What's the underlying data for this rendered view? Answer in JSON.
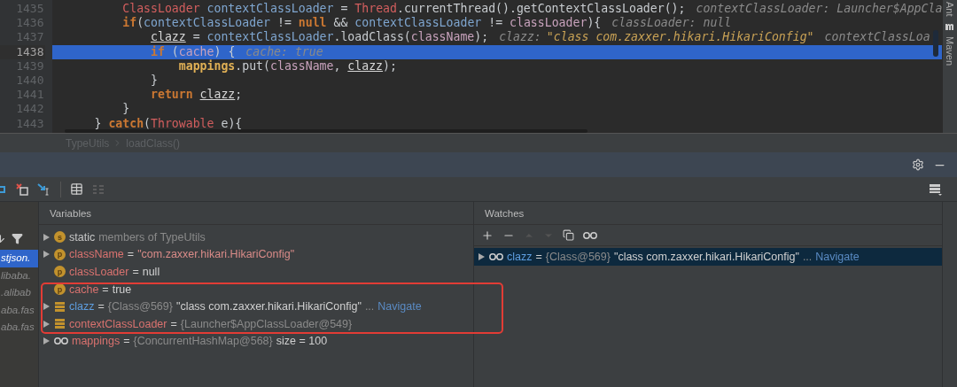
{
  "editor": {
    "lines": [
      {
        "number": "1435",
        "selected": false,
        "tokens": [
          {
            "kind": "type",
            "text": "          ClassLoader"
          },
          {
            "kind": "local",
            "text": " contextClassLoader"
          },
          {
            "kind": "plain",
            "text": " = "
          },
          {
            "kind": "type",
            "text": "Thread"
          },
          {
            "kind": "plain",
            "text": ".currentThread().getContextClassLoader();"
          },
          {
            "kind": "hint",
            "text": "contextClassLoader: Launcher$AppCla"
          }
        ]
      },
      {
        "number": "1436",
        "selected": false,
        "tokens": [
          {
            "kind": "keyword",
            "text": "          if"
          },
          {
            "kind": "plain",
            "text": "("
          },
          {
            "kind": "local",
            "text": "contextClassLoader"
          },
          {
            "kind": "plain",
            "text": " != "
          },
          {
            "kind": "keyword",
            "text": "null"
          },
          {
            "kind": "plain",
            "text": " && "
          },
          {
            "kind": "local",
            "text": "contextClassLoader"
          },
          {
            "kind": "plain",
            "text": " != "
          },
          {
            "kind": "param",
            "text": "classLoader"
          },
          {
            "kind": "plain",
            "text": "){"
          },
          {
            "kind": "hint",
            "text": "classLoader: null"
          }
        ]
      },
      {
        "number": "1437",
        "selected": false,
        "tokens": [
          {
            "kind": "mutated",
            "text": "              clazz"
          },
          {
            "kind": "plain",
            "text": " = "
          },
          {
            "kind": "local",
            "text": "contextClassLoader"
          },
          {
            "kind": "plain",
            "text": ".loadClass("
          },
          {
            "kind": "param",
            "text": "className"
          },
          {
            "kind": "plain",
            "text": ");"
          },
          {
            "kind": "hint",
            "text": "clazz:"
          },
          {
            "kind": "hintstr",
            "text": "\"class com.zaxxer.hikari.HikariConfig\""
          },
          {
            "kind": "hint",
            "text": "contextClassLoa"
          }
        ]
      },
      {
        "number": "1438",
        "selected": true,
        "tokens": [
          {
            "kind": "keyword",
            "text": "              if"
          },
          {
            "kind": "plain",
            "text": " ("
          },
          {
            "kind": "param",
            "text": "cache"
          },
          {
            "kind": "plain",
            "text": ") {"
          },
          {
            "kind": "hint",
            "text": "cache: true"
          }
        ]
      },
      {
        "number": "1439",
        "selected": false,
        "tokens": [
          {
            "kind": "field",
            "text": "                  mappings"
          },
          {
            "kind": "plain",
            "text": ".put("
          },
          {
            "kind": "param",
            "text": "className"
          },
          {
            "kind": "plain",
            "text": ", "
          },
          {
            "kind": "mutated",
            "text": "clazz"
          },
          {
            "kind": "plain",
            "text": ");"
          }
        ]
      },
      {
        "number": "1440",
        "selected": false,
        "tokens": [
          {
            "kind": "plain",
            "text": "              }"
          }
        ]
      },
      {
        "number": "1441",
        "selected": false,
        "tokens": [
          {
            "kind": "keyword",
            "text": "              return"
          },
          {
            "kind": "mutated",
            "text": " clazz"
          },
          {
            "kind": "plain",
            "text": ";"
          }
        ]
      },
      {
        "number": "1442",
        "selected": false,
        "tokens": [
          {
            "kind": "plain",
            "text": "          }"
          }
        ]
      },
      {
        "number": "1443",
        "selected": false,
        "tokens": [
          {
            "kind": "plain",
            "text": "      } "
          },
          {
            "kind": "keyword",
            "text": "catch"
          },
          {
            "kind": "plain",
            "text": "("
          },
          {
            "kind": "type",
            "text": "Throwable"
          },
          {
            "kind": "plain",
            "text": " e){"
          }
        ]
      }
    ]
  },
  "side_tabs": [
    "Ant",
    "Maven"
  ],
  "breadcrumb": [
    "TypeUtils",
    "loadClass()"
  ],
  "frames": [
    {
      "label": "stjson.",
      "selected": true
    },
    {
      "label": "libaba.",
      "selected": false
    },
    {
      "label": ".alibab",
      "selected": false
    },
    {
      "label": "aba.fas",
      "selected": false
    },
    {
      "label": "aba.fas",
      "selected": false
    }
  ],
  "variables": {
    "title": "Variables",
    "items": [
      {
        "kind": "static",
        "icon_letter": "s",
        "expandable": true,
        "name": "static",
        "color": "#c8c8c8",
        "parts": [
          {
            "kind": "dim",
            "text": "members of TypeUtils"
          }
        ]
      },
      {
        "kind": "param",
        "icon_letter": "p",
        "expandable": true,
        "name": "className",
        "color": "#d9726f",
        "parts": [
          {
            "kind": "plain",
            "text": "="
          },
          {
            "kind": "string",
            "text": "\"com.zaxxer.hikari.HikariConfig\""
          }
        ]
      },
      {
        "kind": "param",
        "icon_letter": "p",
        "expandable": false,
        "name": "classLoader",
        "color": "#d9726f",
        "parts": [
          {
            "kind": "plain",
            "text": "="
          },
          {
            "kind": "plain",
            "text": "null"
          }
        ]
      },
      {
        "kind": "param",
        "icon_letter": "p",
        "expandable": false,
        "name": "cache",
        "color": "#d9726f",
        "parts": [
          {
            "kind": "plain",
            "text": "="
          },
          {
            "kind": "plain",
            "text": "true"
          }
        ]
      },
      {
        "kind": "field",
        "expandable": true,
        "name": "clazz",
        "color": "#5e9ee0",
        "parts": [
          {
            "kind": "plain",
            "text": "="
          },
          {
            "kind": "dim",
            "text": "{Class@569}"
          },
          {
            "kind": "plain",
            "text": "\"class com.zaxxer.hikari.HikariConfig\""
          },
          {
            "kind": "dim",
            "text": "..."
          },
          {
            "kind": "link",
            "text": "Navigate"
          }
        ]
      },
      {
        "kind": "field",
        "expandable": true,
        "name": "contextClassLoader",
        "color": "#d9726f",
        "parts": [
          {
            "kind": "plain",
            "text": "="
          },
          {
            "kind": "dim",
            "text": "{Launcher$AppClassLoader@549}"
          }
        ]
      },
      {
        "kind": "watch",
        "expandable": true,
        "name": "mappings",
        "color": "#d9726f",
        "parts": [
          {
            "kind": "plain",
            "text": "="
          },
          {
            "kind": "dim",
            "text": "{ConcurrentHashMap@568}"
          },
          {
            "kind": "plain",
            "text": " size = 100"
          }
        ]
      }
    ]
  },
  "watches": {
    "title": "Watches",
    "items": [
      {
        "kind": "watch",
        "expandable": true,
        "selected": true,
        "name": "clazz",
        "color": "#5e9ee0",
        "parts": [
          {
            "kind": "plain",
            "text": "="
          },
          {
            "kind": "dim",
            "text": "{Class@569}"
          },
          {
            "kind": "plain",
            "text": "\"class com.zaxxer.hikari.HikariConfig\""
          },
          {
            "kind": "dim",
            "text": "..."
          },
          {
            "kind": "link",
            "text": "Navigate"
          }
        ]
      }
    ]
  }
}
